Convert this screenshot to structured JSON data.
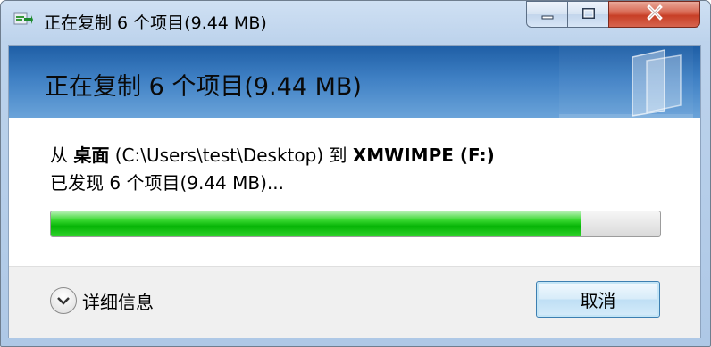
{
  "window": {
    "title": "正在复制 6 个项目(9.44 MB)",
    "title_icon": "copy-files-icon",
    "controls": {
      "minimize": "minimize-icon",
      "maximize": "maximize-icon",
      "close": "close-icon"
    }
  },
  "header": {
    "title": "正在复制 6 个项目(9.44 MB)"
  },
  "transfer": {
    "from_word": "从",
    "source_name": "桌面",
    "source_path": "(C:\\Users\\test\\Desktop)",
    "to_word": "到",
    "destination": "XMWIMPE (F:)",
    "discovered": "已发现 6 个项目(9.44 MB)...",
    "progress": 0.87
  },
  "footer": {
    "details_label": "详细信息",
    "details_icon": "chevron-down-icon",
    "cancel_label": "取消"
  },
  "colors": {
    "progress_green": "#06b406",
    "header_blue": "#3f80c4",
    "close_red": "#c73f26"
  }
}
